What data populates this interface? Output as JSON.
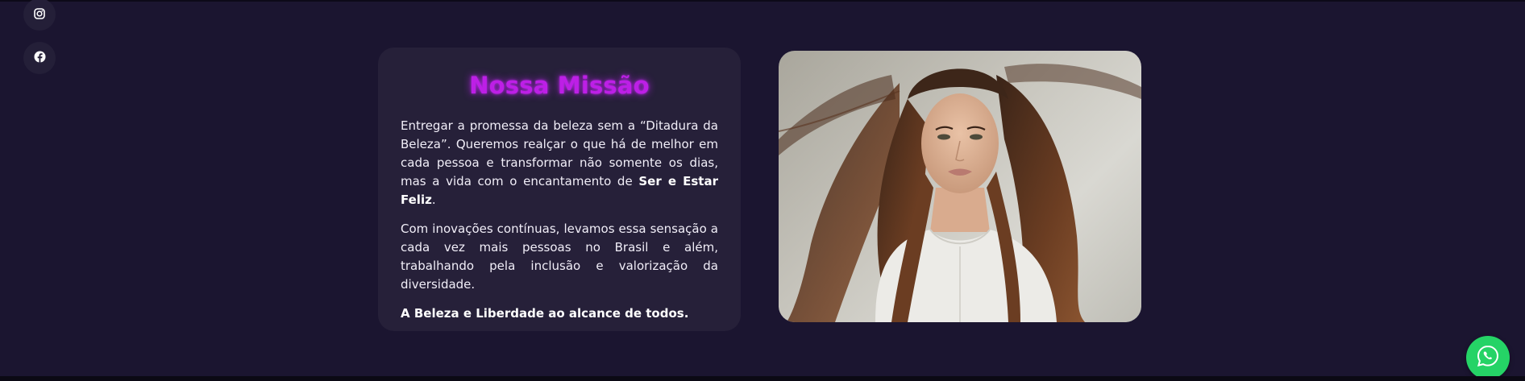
{
  "social": {
    "instagram_icon": "instagram-icon",
    "facebook_icon": "facebook-icon"
  },
  "mission": {
    "title": "Nossa Missão",
    "para1_before": "Entregar a promessa da beleza sem a “Ditadura da Beleza”. Queremos realçar o que há de melhor em cada pessoa e transformar não somente os dias, mas a vida com o encantamento de ",
    "para1_bold": "Ser e Estar Feliz",
    "para1_after": ".",
    "para2": "Com inovações contínuas, levamos essa sensação a cada vez mais pessoas no Brasil e além, trabalhando pela inclusão e valorização da diversidade.",
    "tagline": "A Beleza e Liberdade ao alcance de todos."
  },
  "whatsapp": {
    "icon": "whatsapp-icon"
  },
  "colors": {
    "background": "#1b1530",
    "card": "#262039",
    "title_accent": "#bd1fe6",
    "whatsapp": "#25d366"
  }
}
